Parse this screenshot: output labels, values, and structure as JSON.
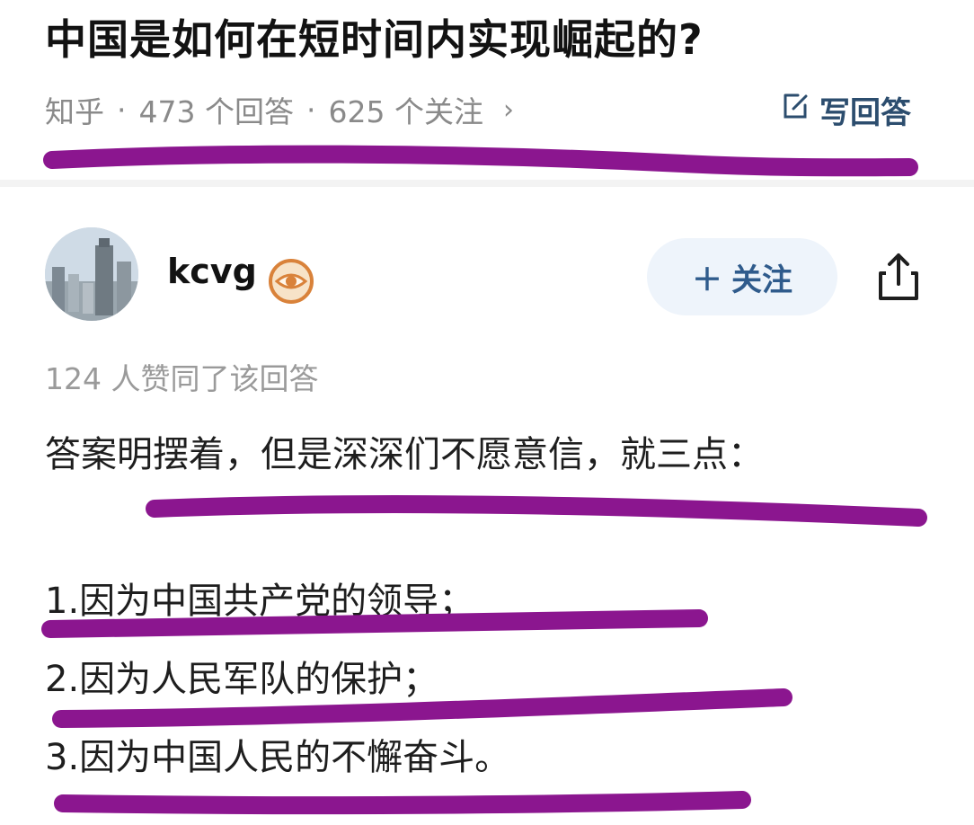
{
  "question": {
    "title": "中国是如何在短时间内实现崛起的?",
    "source": "知乎",
    "answer_count": "473 个回答",
    "follow_count": "625 个关注",
    "write_answer_label": "写回答"
  },
  "author": {
    "name": "kcvg",
    "follow_label": "关注"
  },
  "answer": {
    "likes": "124 人赞同了该回答",
    "intro": "答案明摆着，但是深深们不愿意信，就三点：",
    "points": [
      "1.因为中国共产党的领导；",
      "2.因为人民军队的保护；",
      "3.因为中国人民的不懈奋斗。"
    ]
  },
  "colors": {
    "highlight_stroke": "#8b168f",
    "follow_bg": "#eef4fb",
    "write_answer": "#2c4d6e"
  },
  "icons": [
    "edit-icon",
    "chevron-right-icon",
    "plus-icon",
    "share-icon",
    "eye-badge-icon"
  ]
}
